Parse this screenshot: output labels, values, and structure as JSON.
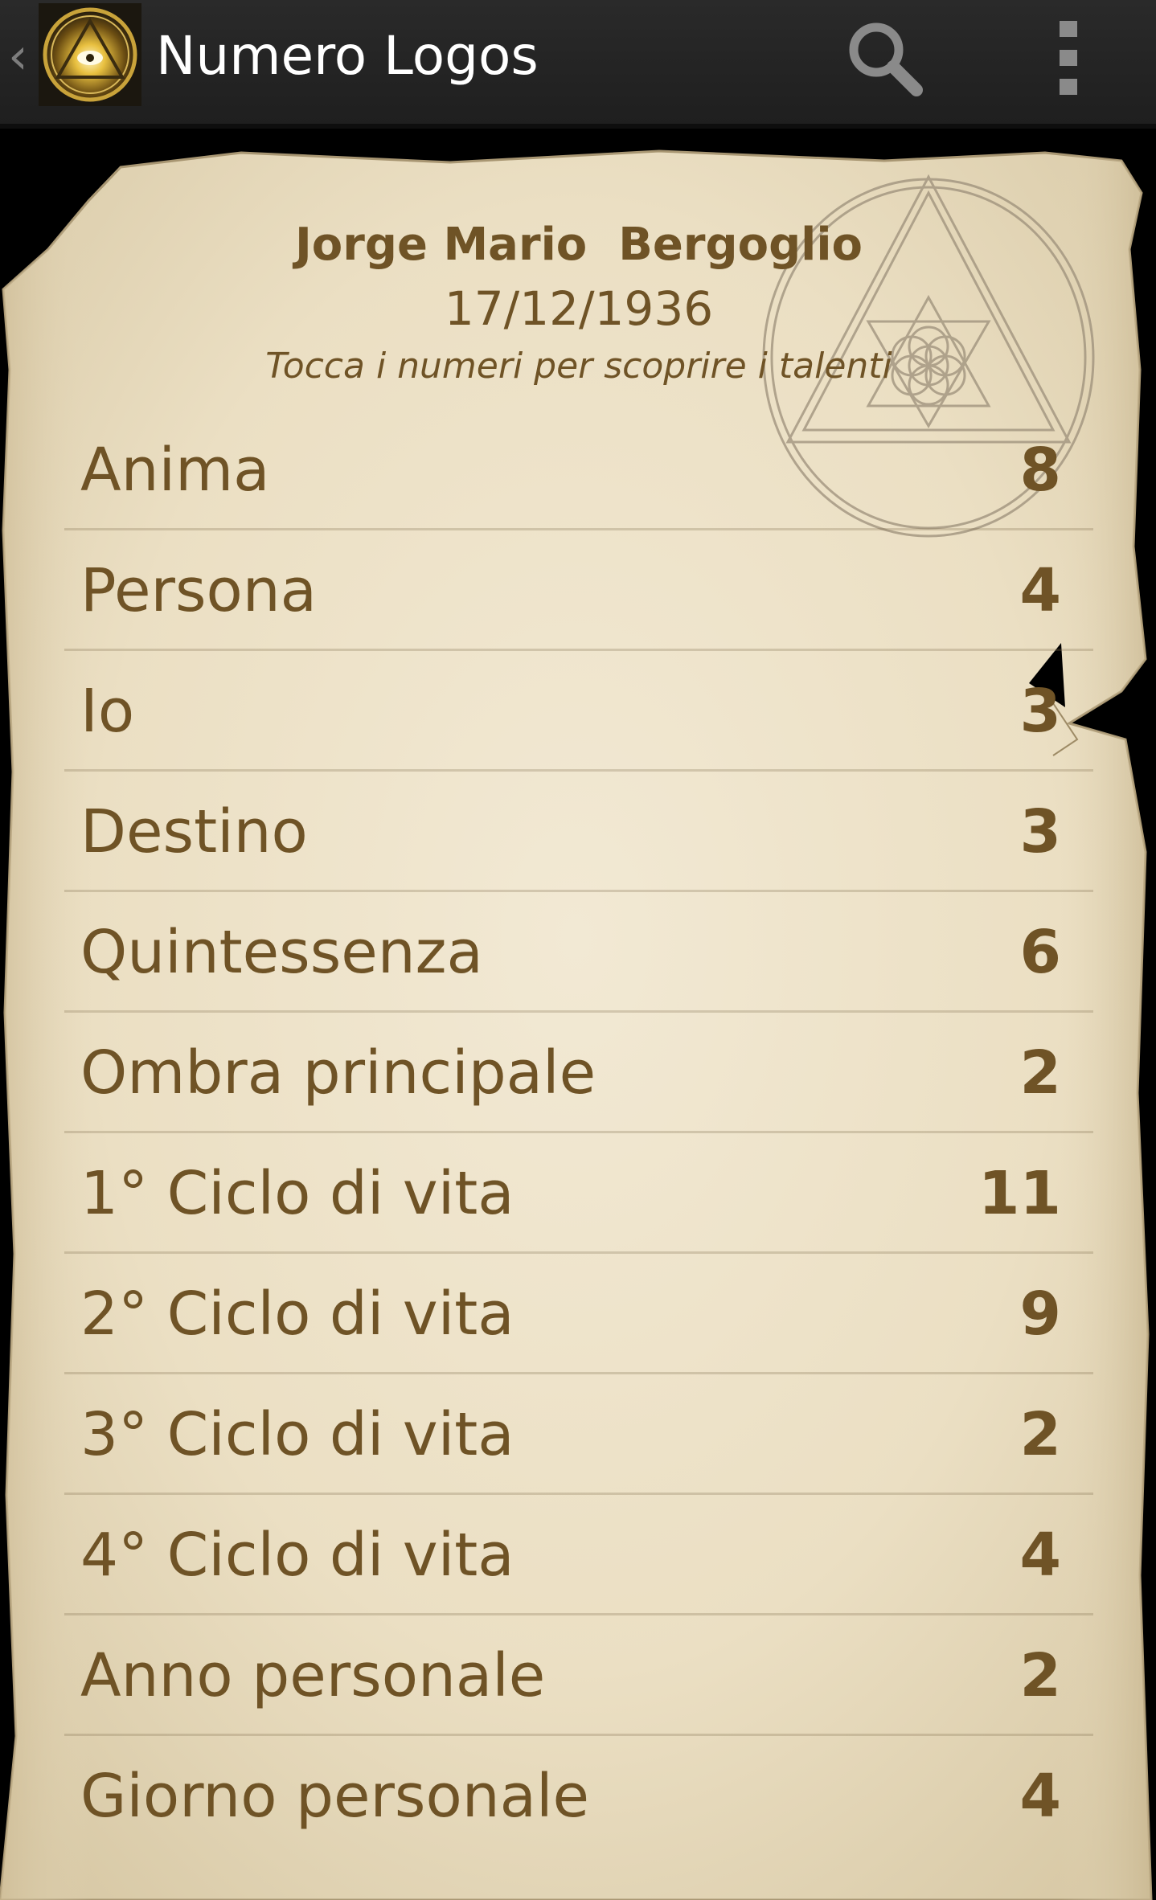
{
  "app_bar": {
    "title": "Numero Logos",
    "up_glyph": "‹",
    "logo_icon": "all-seeing-eye-triangle-icon",
    "search_icon": "search-icon",
    "overflow_icon": "overflow-menu-icon"
  },
  "profile": {
    "name": "Jorge Mario  Bergoglio",
    "birth_date": "17/12/1936",
    "hint": "Tocca i numeri per scoprire i talenti"
  },
  "talents": [
    {
      "label": "Anima",
      "value": "8"
    },
    {
      "label": "Persona",
      "value": "4"
    },
    {
      "label": "Io",
      "value": "3"
    },
    {
      "label": "Destino",
      "value": "3"
    },
    {
      "label": "Quintessenza",
      "value": "6"
    },
    {
      "label": "Ombra principale",
      "value": "2"
    },
    {
      "label": "1° Ciclo di vita",
      "value": "11"
    },
    {
      "label": "2° Ciclo di vita",
      "value": "9"
    },
    {
      "label": "3° Ciclo di vita",
      "value": "2"
    },
    {
      "label": "4° Ciclo di vita",
      "value": "4"
    },
    {
      "label": "Anno personale",
      "value": "2"
    },
    {
      "label": "Giorno personale",
      "value": "4"
    }
  ],
  "colors": {
    "action_bar": "#262626",
    "parchment": "#ece1c8",
    "ink": "#6f5326",
    "title_text": "#ffffff"
  }
}
